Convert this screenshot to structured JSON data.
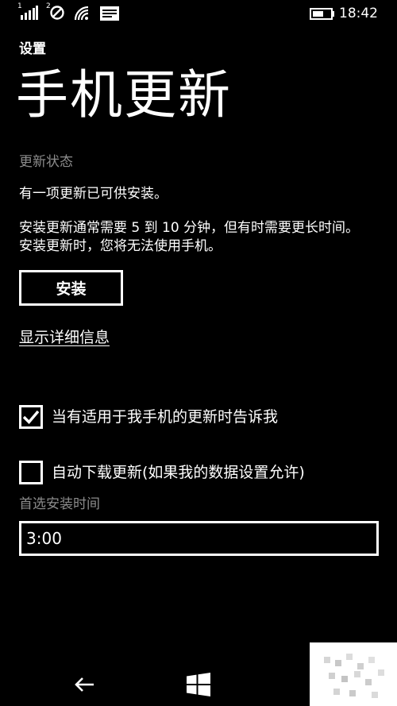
{
  "status_bar": {
    "sim1_label": "1",
    "sim2_label": "2",
    "time": "18:42",
    "icons": [
      "signal-strength-icon",
      "sim2-no-signal-icon",
      "wifi-icon",
      "message-icon",
      "battery-icon"
    ]
  },
  "header": {
    "app_title": "设置",
    "page_title": "手机更新"
  },
  "update": {
    "status_heading": "更新状态",
    "status_text": "有一项更新已可供安装。",
    "description": "安装更新通常需要 5 到 10 分钟，但有时需要更长时间。安装更新时，您将无法使用手机。",
    "install_button": "安装",
    "details_link": "显示详细信息"
  },
  "options": {
    "notify": {
      "label": "当有适用于我手机的更新时告诉我",
      "checked": true
    },
    "auto_download": {
      "label": "自动下载更新(如果我的数据设置允许)",
      "checked": false
    }
  },
  "install_time": {
    "label": "首选安装时间",
    "value": "3:00"
  },
  "nav": {
    "icons": [
      "back-arrow-icon",
      "windows-start-icon"
    ]
  },
  "colors": {
    "background": "#000000",
    "text": "#ffffff",
    "muted": "#8c8c8c"
  }
}
